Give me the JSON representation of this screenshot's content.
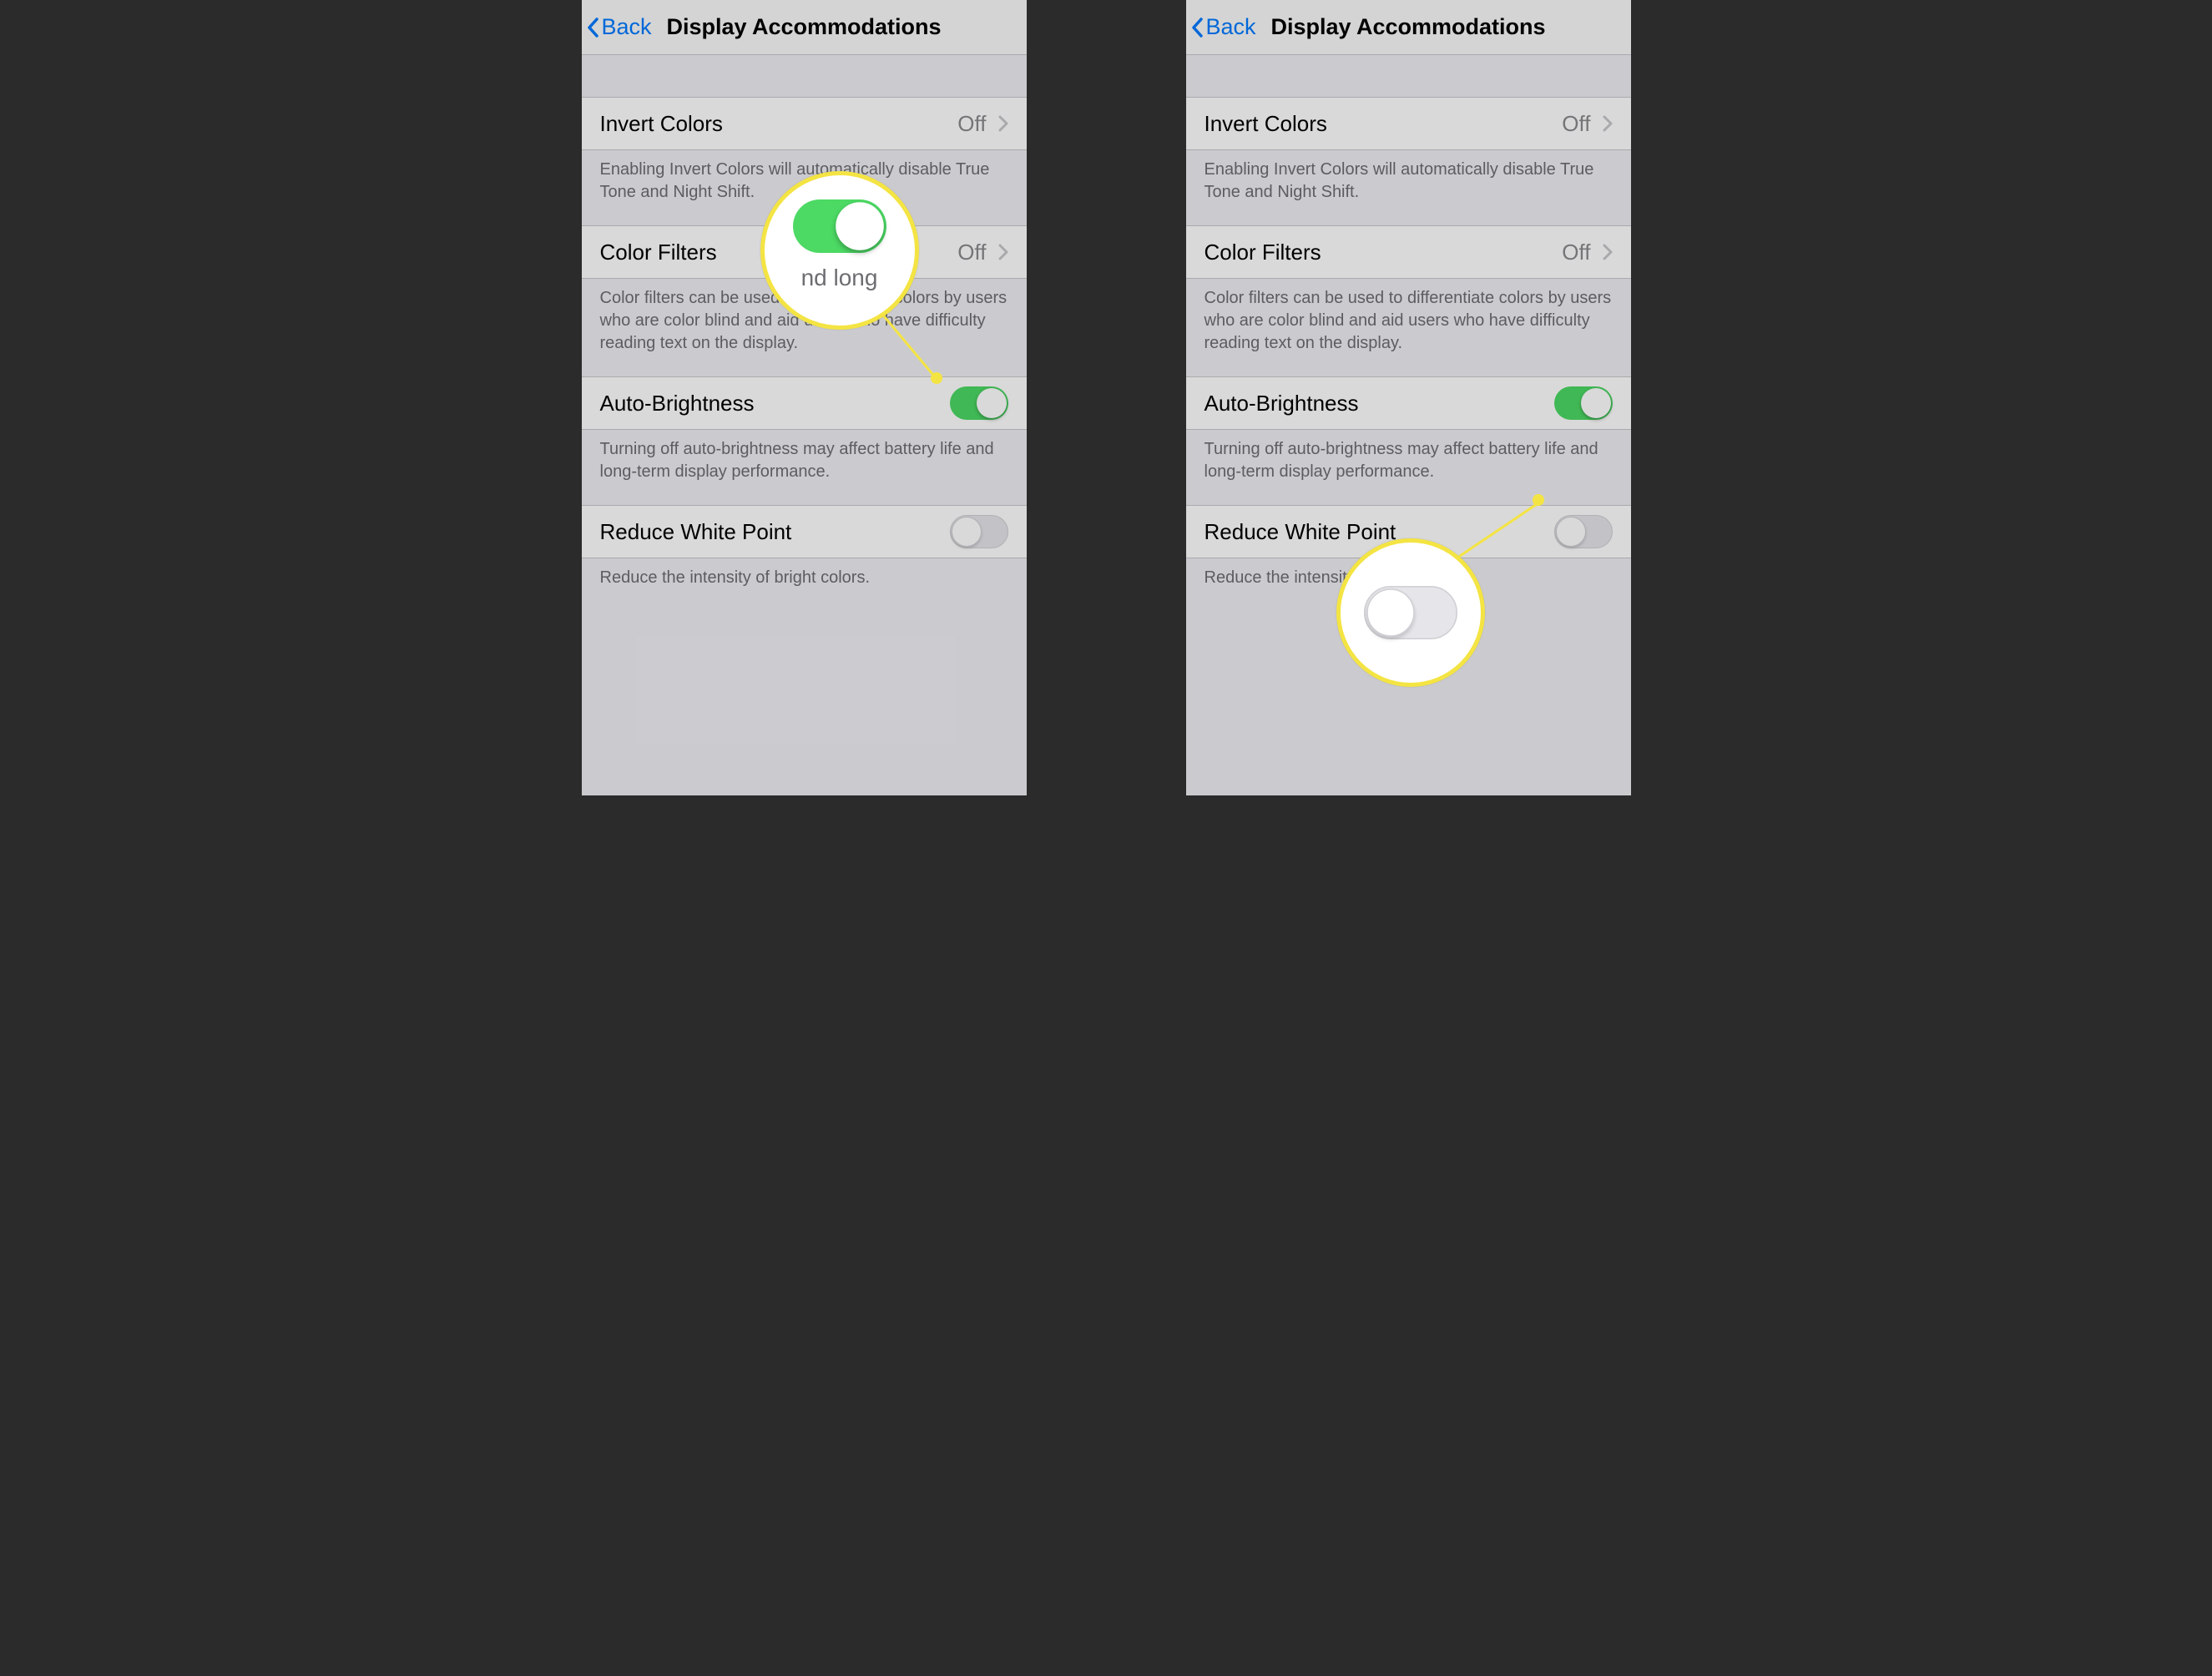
{
  "nav": {
    "back": "Back",
    "title": "Display Accommodations"
  },
  "rows": {
    "invert": {
      "label": "Invert Colors",
      "value": "Off",
      "footer": "Enabling Invert Colors will automatically disable True Tone and Night Shift."
    },
    "filters": {
      "label": "Color Filters",
      "value": "Off",
      "footer": "Color filters can be used to differentiate colors by users who are color blind and aid users who have difficulty reading text on the display."
    },
    "auto": {
      "label": "Auto-Brightness",
      "on": true,
      "footer": "Turning off auto-brightness may affect battery life and long-term display performance."
    },
    "white": {
      "label": "Reduce White Point",
      "on": false,
      "footer": "Reduce the intensity of bright colors."
    }
  },
  "callout_left_fragment": "nd long"
}
